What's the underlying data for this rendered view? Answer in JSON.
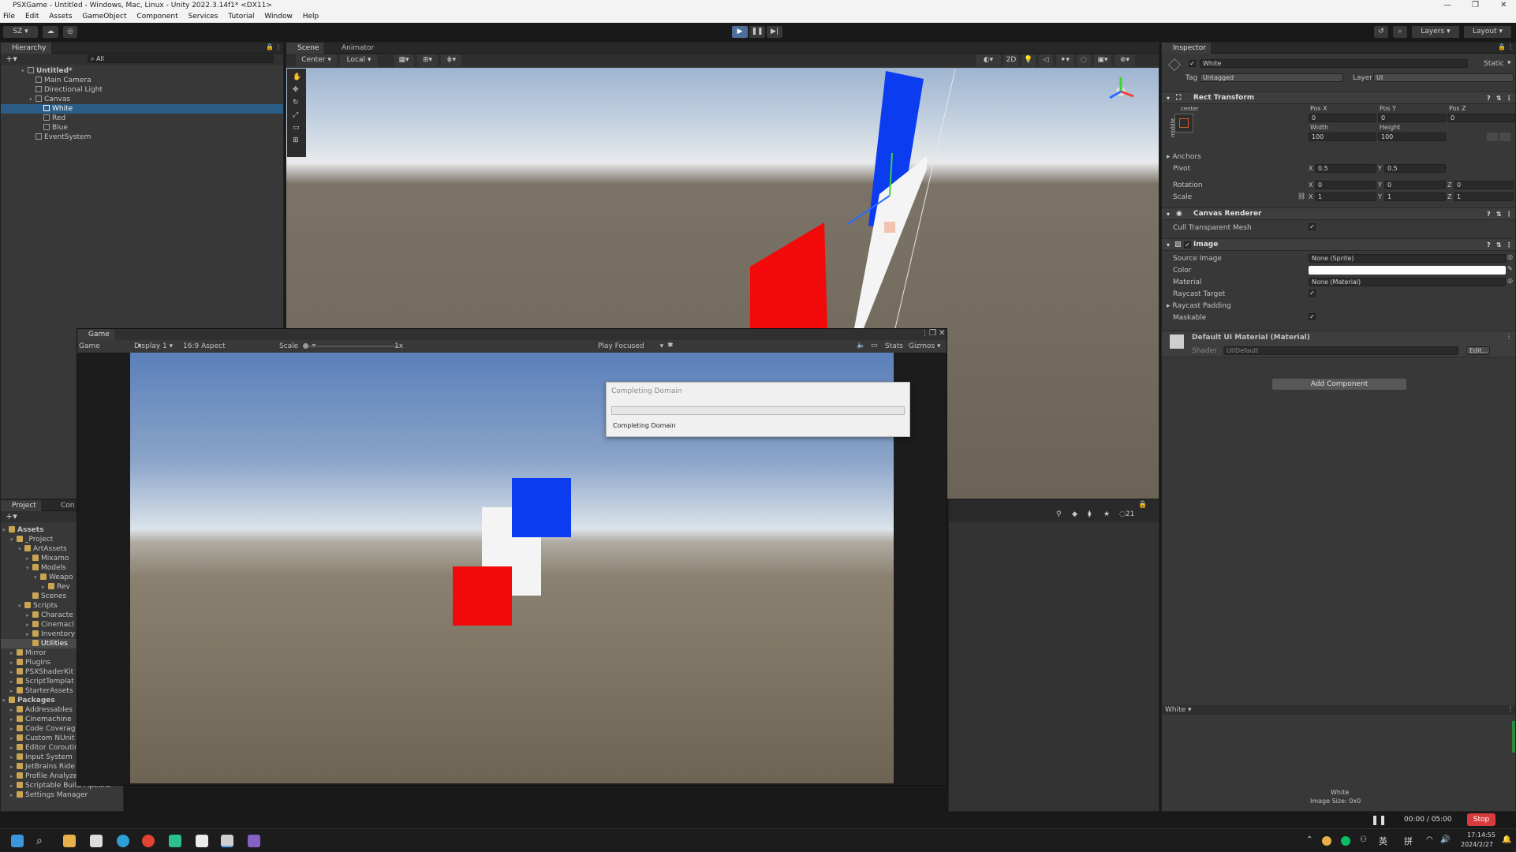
{
  "window": {
    "title": "PSXGame - Untitled - Windows, Mac, Linux - Unity 2022.3.14f1* <DX11>"
  },
  "menu": [
    "File",
    "Edit",
    "Assets",
    "GameObject",
    "Component",
    "Services",
    "Tutorial",
    "Window",
    "Help"
  ],
  "toolbar": {
    "account": "SZ",
    "layers": "Layers",
    "layout": "Layout"
  },
  "hierarchy": {
    "tab": "Hierarchy",
    "search_placeholder": "All",
    "items": [
      {
        "label": "Untitled*"
      },
      {
        "label": "Main Camera"
      },
      {
        "label": "Directional Light"
      },
      {
        "label": "Canvas"
      },
      {
        "label": "White"
      },
      {
        "label": "Red"
      },
      {
        "label": "Blue"
      },
      {
        "label": "EventSystem"
      }
    ]
  },
  "scene": {
    "tabs": [
      "Scene",
      "Animator"
    ],
    "pivot_mode": "Center",
    "pivot_space": "Local",
    "mode_2d": "2D",
    "colors": {
      "sky_top": "#9eb4d0",
      "sky_horizon": "#e8eaec",
      "ground": "#6b6355",
      "blue": "#0b3cf0",
      "red": "#f20a0a",
      "white": "#f4f4f4"
    }
  },
  "game": {
    "tab": "Game",
    "mode": "Game",
    "display": "Display 1",
    "aspect": "16:9 Aspect",
    "scale_label": "Scale",
    "scale_value": "1x",
    "play_mode": "Play Focused",
    "stats": "Stats",
    "gizmos": "Gizmos"
  },
  "dialog": {
    "title": "Completing Domain",
    "message": "Completing Domain"
  },
  "project": {
    "tabs": [
      "Project",
      "Con"
    ],
    "tree": [
      {
        "label": "Assets"
      },
      {
        "label": "_Project"
      },
      {
        "label": "ArtAssets"
      },
      {
        "label": "Mixamo"
      },
      {
        "label": "Models"
      },
      {
        "label": "Weapo"
      },
      {
        "label": "Rev"
      },
      {
        "label": "Scenes"
      },
      {
        "label": "Scripts"
      },
      {
        "label": "Characte"
      },
      {
        "label": "Cinemacl"
      },
      {
        "label": "Inventory"
      },
      {
        "label": "Utilities"
      },
      {
        "label": "Mirror"
      },
      {
        "label": "Plugins"
      },
      {
        "label": "PSXShaderKit"
      },
      {
        "label": "ScriptTemplat"
      },
      {
        "label": "StarterAssets"
      },
      {
        "label": "Packages"
      },
      {
        "label": "Addressables"
      },
      {
        "label": "Cinemachine"
      },
      {
        "label": "Code Coverag"
      },
      {
        "label": "Custom NUnit"
      },
      {
        "label": "Editor Coroutir"
      },
      {
        "label": "Input System"
      },
      {
        "label": "JetBrains Ride"
      },
      {
        "label": "Profile Analyzer"
      },
      {
        "label": "Scriptable Build Pipeline"
      },
      {
        "label": "Settings Manager"
      }
    ],
    "console_count": "21"
  },
  "inspector": {
    "tab": "Inspector",
    "object_name": "White",
    "static_label": "Static",
    "tag_label": "Tag",
    "tag_value": "Untagged",
    "layer_label": "Layer",
    "layer_value": "UI",
    "rect_transform": {
      "title": "Rect Transform",
      "anchor_preset": "center",
      "anchor_side": "middle",
      "pos_x_label": "Pos X",
      "pos_x": "0",
      "pos_y_label": "Pos Y",
      "pos_y": "0",
      "pos_z_label": "Pos Z",
      "pos_z": "0",
      "width_label": "Width",
      "width": "100",
      "height_label": "Height",
      "height": "100",
      "anchors_label": "Anchors",
      "pivot_label": "Pivot",
      "pivot_x": "0.5",
      "pivot_y": "0.5",
      "rotation_label": "Rotation",
      "rot_x": "0",
      "rot_y": "0",
      "rot_z": "0",
      "scale_label": "Scale",
      "scale_x": "1",
      "scale_y": "1",
      "scale_z": "1",
      "axis_x": "X",
      "axis_y": "Y",
      "axis_z": "Z"
    },
    "canvas_renderer": {
      "title": "Canvas Renderer",
      "cull_label": "Cull Transparent Mesh"
    },
    "image": {
      "title": "Image",
      "source_image_label": "Source Image",
      "source_image": "None (Sprite)",
      "color_label": "Color",
      "color": "#ffffff",
      "material_label": "Material",
      "material": "None (Material)",
      "raycast_target_label": "Raycast Target",
      "raycast_padding_label": "Raycast Padding",
      "maskable_label": "Maskable"
    },
    "material": {
      "title": "Default UI Material (Material)",
      "shader_label": "Shader",
      "shader_value": "UI/Default",
      "edit_label": "Edit..."
    },
    "add_component": "Add Component",
    "preview_dropdown": "White",
    "preview_name": "White",
    "preview_size": "Image Size: 0x0"
  },
  "recorder": {
    "time": "00:00 / 05:00",
    "stop": "Stop"
  },
  "taskbar": {
    "time": "17:14:55",
    "date": "2024/2/27",
    "ime1": "英",
    "ime2": "拼"
  }
}
